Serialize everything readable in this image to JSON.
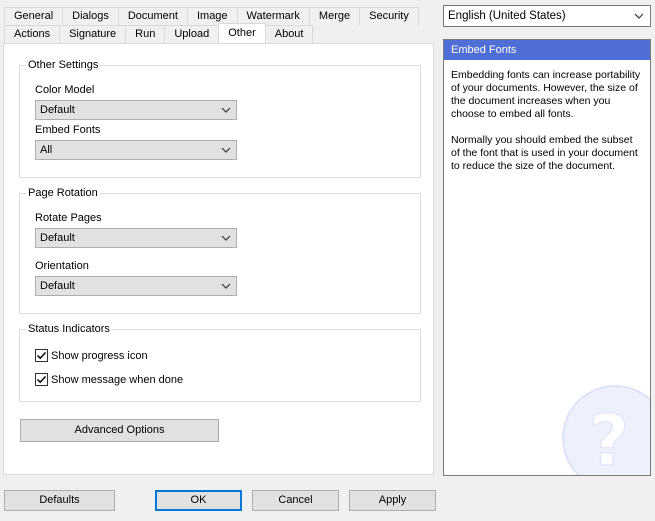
{
  "tabs": {
    "top": [
      "General",
      "Dialogs",
      "Document",
      "Image",
      "Watermark",
      "Merge",
      "Security"
    ],
    "bottom": [
      "Actions",
      "Signature",
      "Run",
      "Upload",
      "Other",
      "About"
    ],
    "active": "Other"
  },
  "other_settings": {
    "title": "Other Settings",
    "color_model_label": "Color Model",
    "color_model_value": "Default",
    "embed_fonts_label": "Embed Fonts",
    "embed_fonts_value": "All"
  },
  "page_rotation": {
    "title": "Page Rotation",
    "rotate_pages_label": "Rotate Pages",
    "rotate_pages_value": "Default",
    "orientation_label": "Orientation",
    "orientation_value": "Default"
  },
  "status_indicators": {
    "title": "Status Indicators",
    "show_progress_label": "Show progress icon",
    "show_progress_checked": true,
    "show_message_label": "Show message when done",
    "show_message_checked": true
  },
  "advanced_options_label": "Advanced Options",
  "footer": {
    "defaults": "Defaults",
    "ok": "OK",
    "cancel": "Cancel",
    "apply": "Apply"
  },
  "language": {
    "value": "English (United States)"
  },
  "help": {
    "title": "Embed Fonts",
    "paragraph1": "Embedding fonts can increase portability of your documents. However, the size of the document increases when you choose to embed all fonts.",
    "paragraph2": "Normally you should embed the subset of the font that is used in your document to reduce the size of the document."
  },
  "icons": {
    "dropdown": "chevron-down-icon",
    "check": "check-icon",
    "help": "question-mark-icon"
  },
  "colors": {
    "help_header": "#4f6fd7",
    "focus_border": "#0078d7"
  }
}
